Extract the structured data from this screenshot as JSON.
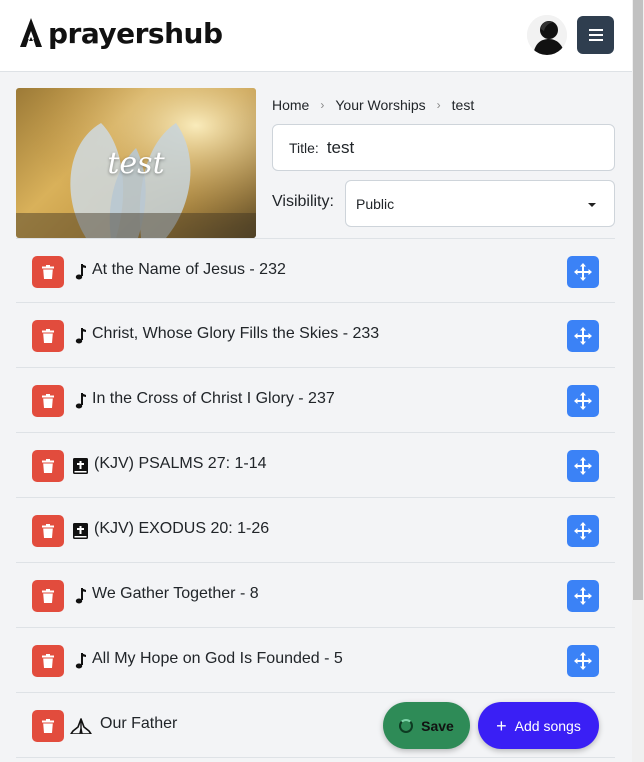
{
  "brand": {
    "name": "prayershub",
    "icon": "praying-hands-logo"
  },
  "header": {
    "avatar_icon": "user-silhouette-avatar",
    "menu_icon": "hamburger-menu-icon"
  },
  "breadcrumb": [
    "Home",
    "Your Worships",
    "test"
  ],
  "cover": {
    "title": "test"
  },
  "form": {
    "title_label": "Title:",
    "title_value": "test",
    "visibility_label": "Visibility:",
    "visibility_value": "Public"
  },
  "items": [
    {
      "type": "song",
      "label": "At the Name of Jesus - 232"
    },
    {
      "type": "song",
      "label": "Christ, Whose Glory Fills the Skies - 233"
    },
    {
      "type": "song",
      "label": "In the Cross of Christ I Glory - 237"
    },
    {
      "type": "bible",
      "label": "(KJV) PSALMS 27: 1-14"
    },
    {
      "type": "bible",
      "label": "(KJV) EXODUS 20: 1-26"
    },
    {
      "type": "song",
      "label": "We Gather Together - 8"
    },
    {
      "type": "song",
      "label": "All My Hope on God Is Founded - 5"
    },
    {
      "type": "prayer",
      "label": "Our Father"
    }
  ],
  "actions": {
    "save_label": "Save",
    "add_label": "Add songs"
  },
  "colors": {
    "delete": "#e24c3d",
    "move": "#3b82f6",
    "save": "#2e8b57",
    "add": "#3a1ff5",
    "menu": "#2f3e4f"
  }
}
